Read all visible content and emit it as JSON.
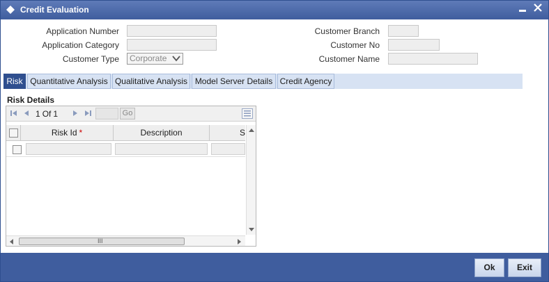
{
  "window": {
    "title": "Credit Evaluation",
    "minimize_label": "▬",
    "close_label": "✕"
  },
  "form": {
    "application_number_label": "Application Number",
    "application_category_label": "Application Category",
    "customer_type_label": "Customer Type",
    "customer_type_value": "Corporate",
    "customer_branch_label": "Customer Branch",
    "customer_no_label": "Customer No",
    "customer_name_label": "Customer Name"
  },
  "tabs": [
    {
      "label": "Risk",
      "active": true
    },
    {
      "label": "Quantitative Analysis",
      "active": false
    },
    {
      "label": "Qualitative Analysis",
      "active": false
    },
    {
      "label": "Model Server Details",
      "active": false
    },
    {
      "label": "Credit Agency",
      "active": false
    }
  ],
  "risk_details": {
    "section_title": "Risk Details",
    "pager": {
      "current": "1",
      "of_label": "Of",
      "total": "1"
    },
    "go_label": "Go",
    "columns": [
      "Risk Id",
      "Description",
      "S"
    ],
    "required_marker": "*",
    "scroll_grip": "III"
  },
  "footer": {
    "ok_label": "Ok",
    "exit_label": "Exit"
  },
  "colors": {
    "titlebar": "#3f5d9e",
    "tab_active": "#2f4f8f",
    "tab_bar": "#d7e2f3",
    "required": "#cc0000"
  }
}
